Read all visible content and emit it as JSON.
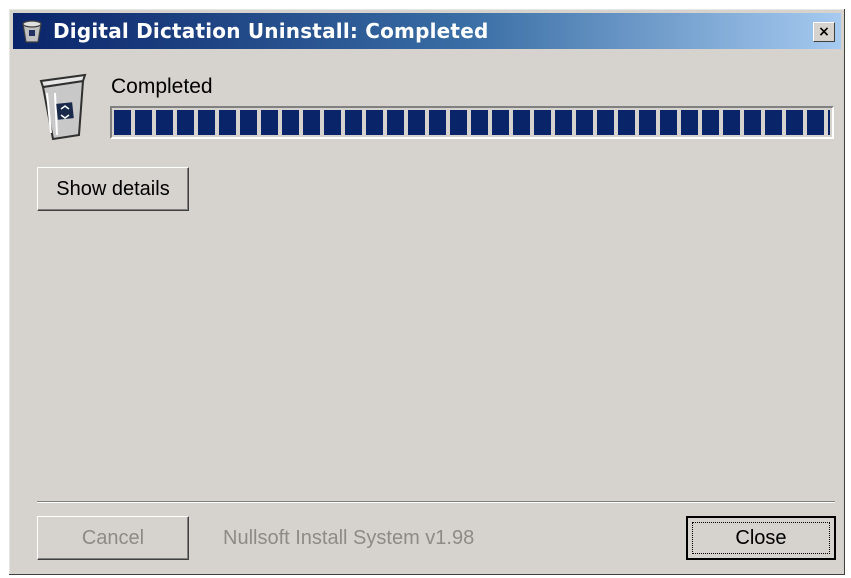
{
  "window": {
    "title": "Digital Dictation Uninstall: Completed",
    "close_glyph": "×",
    "title_icon": "uninstall-bin-icon"
  },
  "status": {
    "label": "Completed",
    "icon": "recycle-bin-icon",
    "progress_fraction": 1.0
  },
  "buttons": {
    "show_details": "Show details",
    "cancel": "Cancel",
    "close": "Close"
  },
  "footer": {
    "branding": "Nullsoft Install System v1.98"
  },
  "colors": {
    "face": "#d6d3ce",
    "title_start": "#0a246a",
    "title_end": "#a6caf0",
    "progress": "#0a246a",
    "disabled_text": "#8e8b86"
  }
}
